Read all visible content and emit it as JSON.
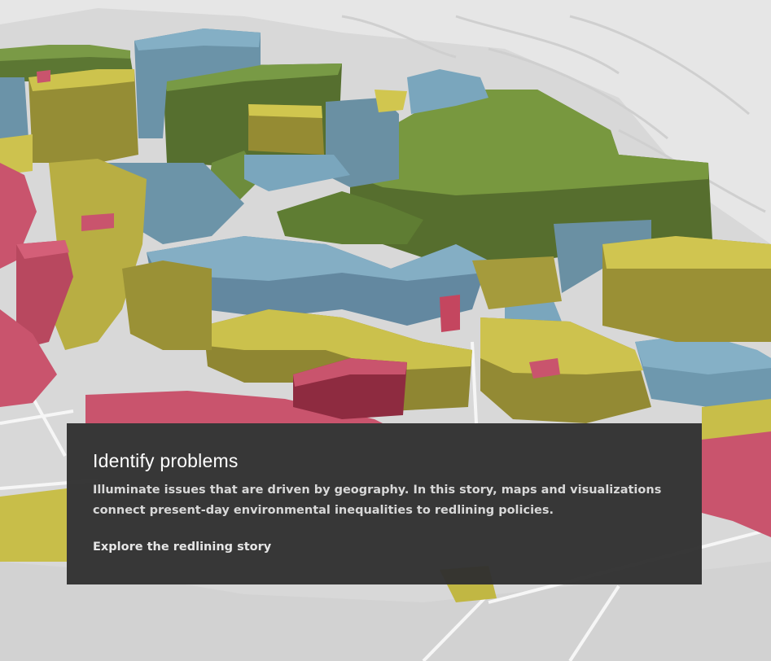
{
  "map": {
    "colors": {
      "basemap": "#dcdcdc",
      "terrain_light": "#ececec",
      "road": "#f7f7f7",
      "grade_a_green": "#6f8f3e",
      "grade_b_blue": "#7aa6bd",
      "grade_c_yellow": "#c8be49",
      "grade_d_red": "#c9546d"
    }
  },
  "card": {
    "title": "Identify problems",
    "body": "Illuminate issues that are driven by geography. In this story, maps and visualizations connect present-day environmental inequalities to redlining policies.",
    "link_label": "Explore the redlining story"
  }
}
